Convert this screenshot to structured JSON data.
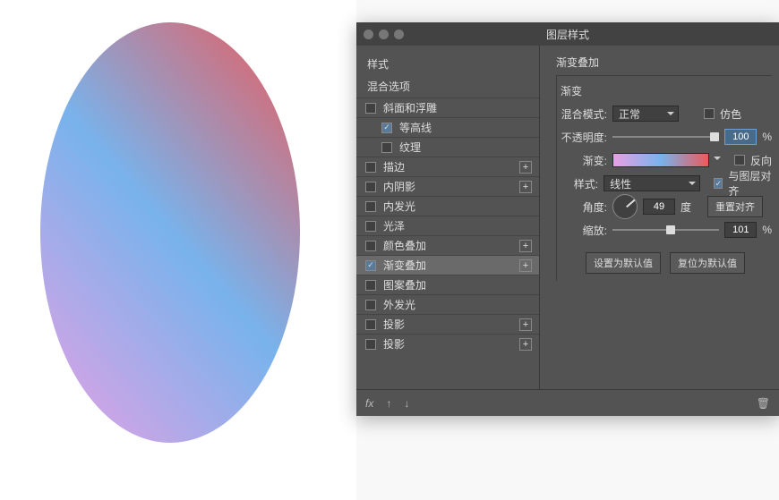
{
  "dialog": {
    "title": "图层样式"
  },
  "sidebar": {
    "header1": "样式",
    "header2": "混合选项",
    "items": [
      {
        "label": "斜面和浮雕",
        "checked": false,
        "plus": false,
        "indent": false
      },
      {
        "label": "等高线",
        "checked": true,
        "plus": false,
        "indent": true
      },
      {
        "label": "纹理",
        "checked": false,
        "plus": false,
        "indent": true
      },
      {
        "label": "描边",
        "checked": false,
        "plus": true,
        "indent": false
      },
      {
        "label": "内阴影",
        "checked": false,
        "plus": true,
        "indent": false
      },
      {
        "label": "内发光",
        "checked": false,
        "plus": false,
        "indent": false
      },
      {
        "label": "光泽",
        "checked": false,
        "plus": false,
        "indent": false
      },
      {
        "label": "颜色叠加",
        "checked": false,
        "plus": true,
        "indent": false
      },
      {
        "label": "渐变叠加",
        "checked": true,
        "plus": true,
        "indent": false,
        "selected": true
      },
      {
        "label": "图案叠加",
        "checked": false,
        "plus": false,
        "indent": false
      },
      {
        "label": "外发光",
        "checked": false,
        "plus": false,
        "indent": false
      },
      {
        "label": "投影",
        "checked": false,
        "plus": true,
        "indent": false
      },
      {
        "label": "投影",
        "checked": false,
        "plus": true,
        "indent": false
      }
    ]
  },
  "panel": {
    "title": "渐变叠加",
    "section": "渐变",
    "blend_label": "混合模式:",
    "blend_value": "正常",
    "dither_label": "仿色",
    "dither_checked": false,
    "opacity_label": "不透明度:",
    "opacity_value": "100",
    "opacity_unit": "%",
    "gradient_label": "渐变:",
    "reverse_label": "反向",
    "reverse_checked": false,
    "style_label": "样式:",
    "style_value": "线性",
    "align_label": "与图层对齐",
    "align_checked": true,
    "angle_label": "角度:",
    "angle_value": "49",
    "angle_unit": "度",
    "reset_align": "重置对齐",
    "scale_label": "缩放:",
    "scale_value": "101",
    "scale_unit": "%",
    "btn_make_default": "设置为默认值",
    "btn_reset_default": "复位为默认值"
  }
}
